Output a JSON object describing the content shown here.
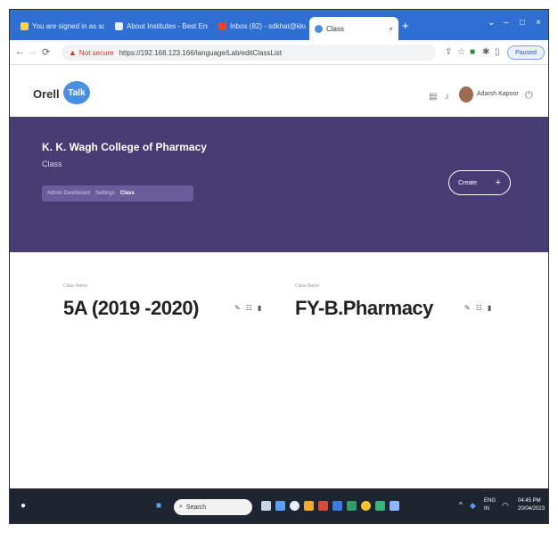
{
  "browser": {
    "tabs": [
      {
        "label": "You are signed in as sdkhat"
      },
      {
        "label": "About Institutes - Best Engineeri"
      },
      {
        "label": "Inbox (82) - sdkhat@kkwagh.ed"
      },
      {
        "label": "Class"
      }
    ],
    "not_secure": "Not secure",
    "url": "https://192.168.123.166/language/Lab/editClassList",
    "paused_label": "Paused"
  },
  "app": {
    "logo_text": "Orell",
    "logo_bubble": "Talk",
    "username": "Adarsh Kapoor"
  },
  "banner": {
    "college": "K. K. Wagh College of Pharmacy",
    "subtitle": "Class",
    "breadcrumb": [
      "Admin Dashboard",
      "Settings",
      "Class"
    ],
    "create_label": "Create",
    "create_plus": "+"
  },
  "classes": [
    {
      "label": "Class Name",
      "name": "5A (2019 -2020)"
    },
    {
      "label": "Class Name",
      "name": "FY-B.Pharmacy"
    }
  ],
  "taskbar": {
    "search_placeholder": "Search",
    "lang_top": "ENG",
    "lang_bottom": "IN",
    "time": "04:45 PM",
    "date": "20/04/2023"
  }
}
